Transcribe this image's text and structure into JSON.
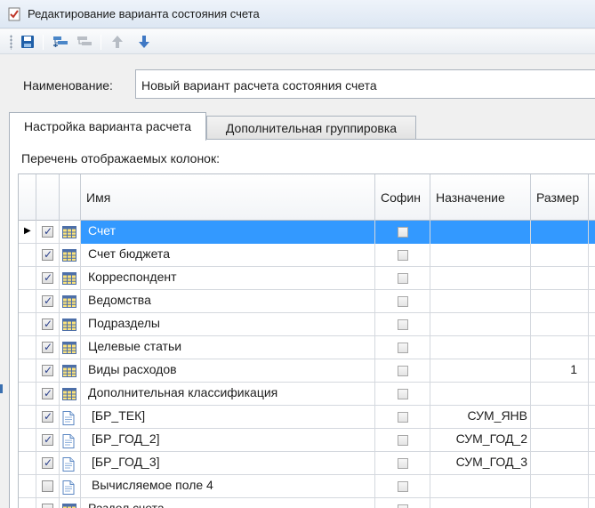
{
  "window": {
    "title": "Редактирование варианта состояния счета"
  },
  "toolbar": {
    "buttons": [
      "save-icon",
      "add-group-icon",
      "remove-group-icon",
      "move-up-icon",
      "move-down-icon"
    ]
  },
  "form": {
    "name_label": "Наименование:",
    "name_value": "Новый вариант расчета состояния счета"
  },
  "tabs": [
    {
      "label": "Настройка варианта расчета",
      "active": true
    },
    {
      "label": "Дополнительная группировка",
      "active": false
    }
  ],
  "columns_label": "Перечень отображаемых колонок:",
  "grid": {
    "headers": {
      "name": "Имя",
      "sofin": "Софин",
      "purpose": "Назначение",
      "size": "Размер"
    },
    "rows": [
      {
        "checked": true,
        "icon": "table-icon",
        "name": "Счет",
        "sofin": false,
        "purpose": "",
        "size": "",
        "selected": true
      },
      {
        "checked": true,
        "icon": "table-icon",
        "name": "Счет бюджета",
        "sofin": false,
        "purpose": "",
        "size": ""
      },
      {
        "checked": true,
        "icon": "table-icon",
        "name": "Корреспондент",
        "sofin": false,
        "purpose": "",
        "size": ""
      },
      {
        "checked": true,
        "icon": "table-icon",
        "name": "Ведомства",
        "sofin": false,
        "purpose": "",
        "size": ""
      },
      {
        "checked": true,
        "icon": "table-icon",
        "name": "Подразделы",
        "sofin": false,
        "purpose": "",
        "size": ""
      },
      {
        "checked": true,
        "icon": "table-icon",
        "name": "Целевые статьи",
        "sofin": false,
        "purpose": "",
        "size": ""
      },
      {
        "checked": true,
        "icon": "table-icon",
        "name": "Виды расходов",
        "sofin": false,
        "purpose": "",
        "size": "1"
      },
      {
        "checked": true,
        "icon": "table-icon",
        "name": "Дополнительная классификация",
        "sofin": false,
        "purpose": "",
        "size": ""
      },
      {
        "checked": true,
        "icon": "document-icon",
        "name": "[БР_ТЕК]",
        "sofin": false,
        "purpose": "СУМ_ЯНВ",
        "size": ""
      },
      {
        "checked": true,
        "icon": "document-icon",
        "name": "[БР_ГОД_2]",
        "sofin": false,
        "purpose": "СУМ_ГОД_2",
        "size": ""
      },
      {
        "checked": true,
        "icon": "document-icon",
        "name": "[БР_ГОД_3]",
        "sofin": false,
        "purpose": "СУМ_ГОД_3",
        "size": ""
      },
      {
        "checked": false,
        "icon": "document-icon",
        "name": "Вычисляемое поле 4",
        "sofin": false,
        "purpose": "",
        "size": ""
      },
      {
        "checked": false,
        "icon": "table-icon",
        "name": "Раздел счета",
        "sofin": false,
        "purpose": "",
        "size": ""
      }
    ]
  }
}
